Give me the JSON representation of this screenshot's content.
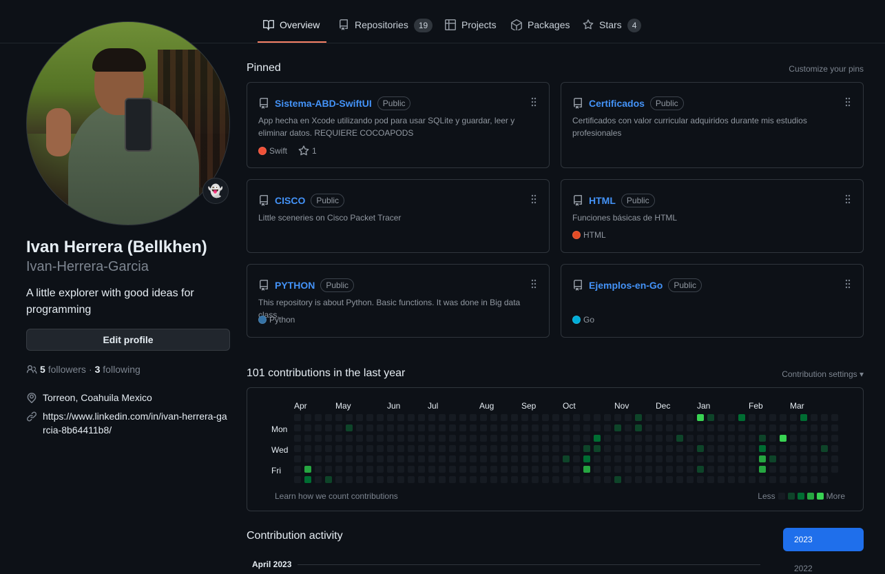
{
  "nav": {
    "tabs": [
      {
        "label": "Overview",
        "icon": "book-icon",
        "active": true
      },
      {
        "label": "Repositories",
        "icon": "repo-icon",
        "count": "19"
      },
      {
        "label": "Projects",
        "icon": "table-icon"
      },
      {
        "label": "Packages",
        "icon": "package-icon"
      },
      {
        "label": "Stars",
        "icon": "star-icon",
        "count": "4"
      }
    ]
  },
  "profile": {
    "name": "Ivan Herrera (Bellkhen)",
    "login": "Ivan-Herrera-Garcia",
    "bio": "A little explorer with good ideas for programming",
    "edit_label": "Edit profile",
    "followers_count": "5",
    "followers_label": "followers",
    "separator": "·",
    "following_count": "3",
    "following_label": "following",
    "location": "Torreon, Coahuila Mexico",
    "link": "https://www.linkedin.com/in/ivan-herrera-garcia-8b64411b8/",
    "status_emoji": "👻"
  },
  "pinned": {
    "title": "Pinned",
    "customize_label": "Customize your pins",
    "repos": [
      {
        "name": "Sistema-ABD-SwiftUI",
        "visibility": "Public",
        "description": "App hecha en Xcode utilizando pod para usar SQLite y guardar, leer y eliminar datos. REQUIERE COCOAPODS",
        "language": "Swift",
        "lang_color": "#F05138",
        "stars": "1"
      },
      {
        "name": "Certificados",
        "visibility": "Public",
        "description": "Certificados con valor curricular adquiridos durante mis estudios profesionales",
        "language": "",
        "lang_color": "",
        "stars": ""
      },
      {
        "name": "CISCO",
        "visibility": "Public",
        "description": "Little sceneries on Cisco Packet Tracer",
        "language": "",
        "lang_color": "",
        "stars": ""
      },
      {
        "name": "HTML",
        "visibility": "Public",
        "description": "Funciones básicas de HTML",
        "language": "HTML",
        "lang_color": "#e34c26",
        "stars": ""
      },
      {
        "name": "PYTHON",
        "visibility": "Public",
        "description": "This repository is about Python. Basic functions. It was done in Big data class.",
        "language": "Python",
        "lang_color": "#3572A5",
        "stars": ""
      },
      {
        "name": "Ejemplos-en-Go",
        "visibility": "Public",
        "description": "",
        "language": "Go",
        "lang_color": "#00ADD8",
        "stars": ""
      }
    ]
  },
  "contributions": {
    "title": "101 contributions in the last year",
    "settings_label": "Contribution settings",
    "months": [
      "Apr",
      "May",
      "Jun",
      "Jul",
      "Aug",
      "Sep",
      "Oct",
      "Nov",
      "Dec",
      "Jan",
      "Feb",
      "Mar"
    ],
    "days": [
      "Mon",
      "Wed",
      "Fri"
    ],
    "learn_label": "Learn how we count contributions",
    "less_label": "Less",
    "more_label": "More",
    "level_colors": [
      "#161b22",
      "#0e4429",
      "#006d32",
      "#26a641",
      "#39d353"
    ],
    "active_cells": [
      [
        1,
        5,
        3
      ],
      [
        1,
        6,
        2
      ],
      [
        3,
        6,
        1
      ],
      [
        5,
        1,
        1
      ],
      [
        26,
        4,
        1
      ],
      [
        28,
        3,
        1
      ],
      [
        28,
        4,
        2
      ],
      [
        28,
        5,
        3
      ],
      [
        29,
        3,
        1
      ],
      [
        29,
        2,
        2
      ],
      [
        31,
        1,
        1
      ],
      [
        31,
        6,
        1
      ],
      [
        33,
        0,
        1
      ],
      [
        33,
        1,
        1
      ],
      [
        37,
        2,
        1
      ],
      [
        39,
        0,
        4
      ],
      [
        39,
        3,
        1
      ],
      [
        39,
        5,
        1
      ],
      [
        40,
        0,
        1
      ],
      [
        43,
        0,
        2
      ],
      [
        45,
        2,
        1
      ],
      [
        45,
        3,
        2
      ],
      [
        45,
        4,
        3
      ],
      [
        45,
        5,
        3
      ],
      [
        46,
        4,
        1
      ],
      [
        47,
        2,
        4
      ],
      [
        49,
        0,
        2
      ],
      [
        51,
        3,
        1
      ],
      [
        53,
        6,
        2
      ]
    ]
  },
  "activity": {
    "title": "Contribution activity",
    "month_label": "April 2023",
    "years": [
      "2023",
      "2022"
    ]
  }
}
